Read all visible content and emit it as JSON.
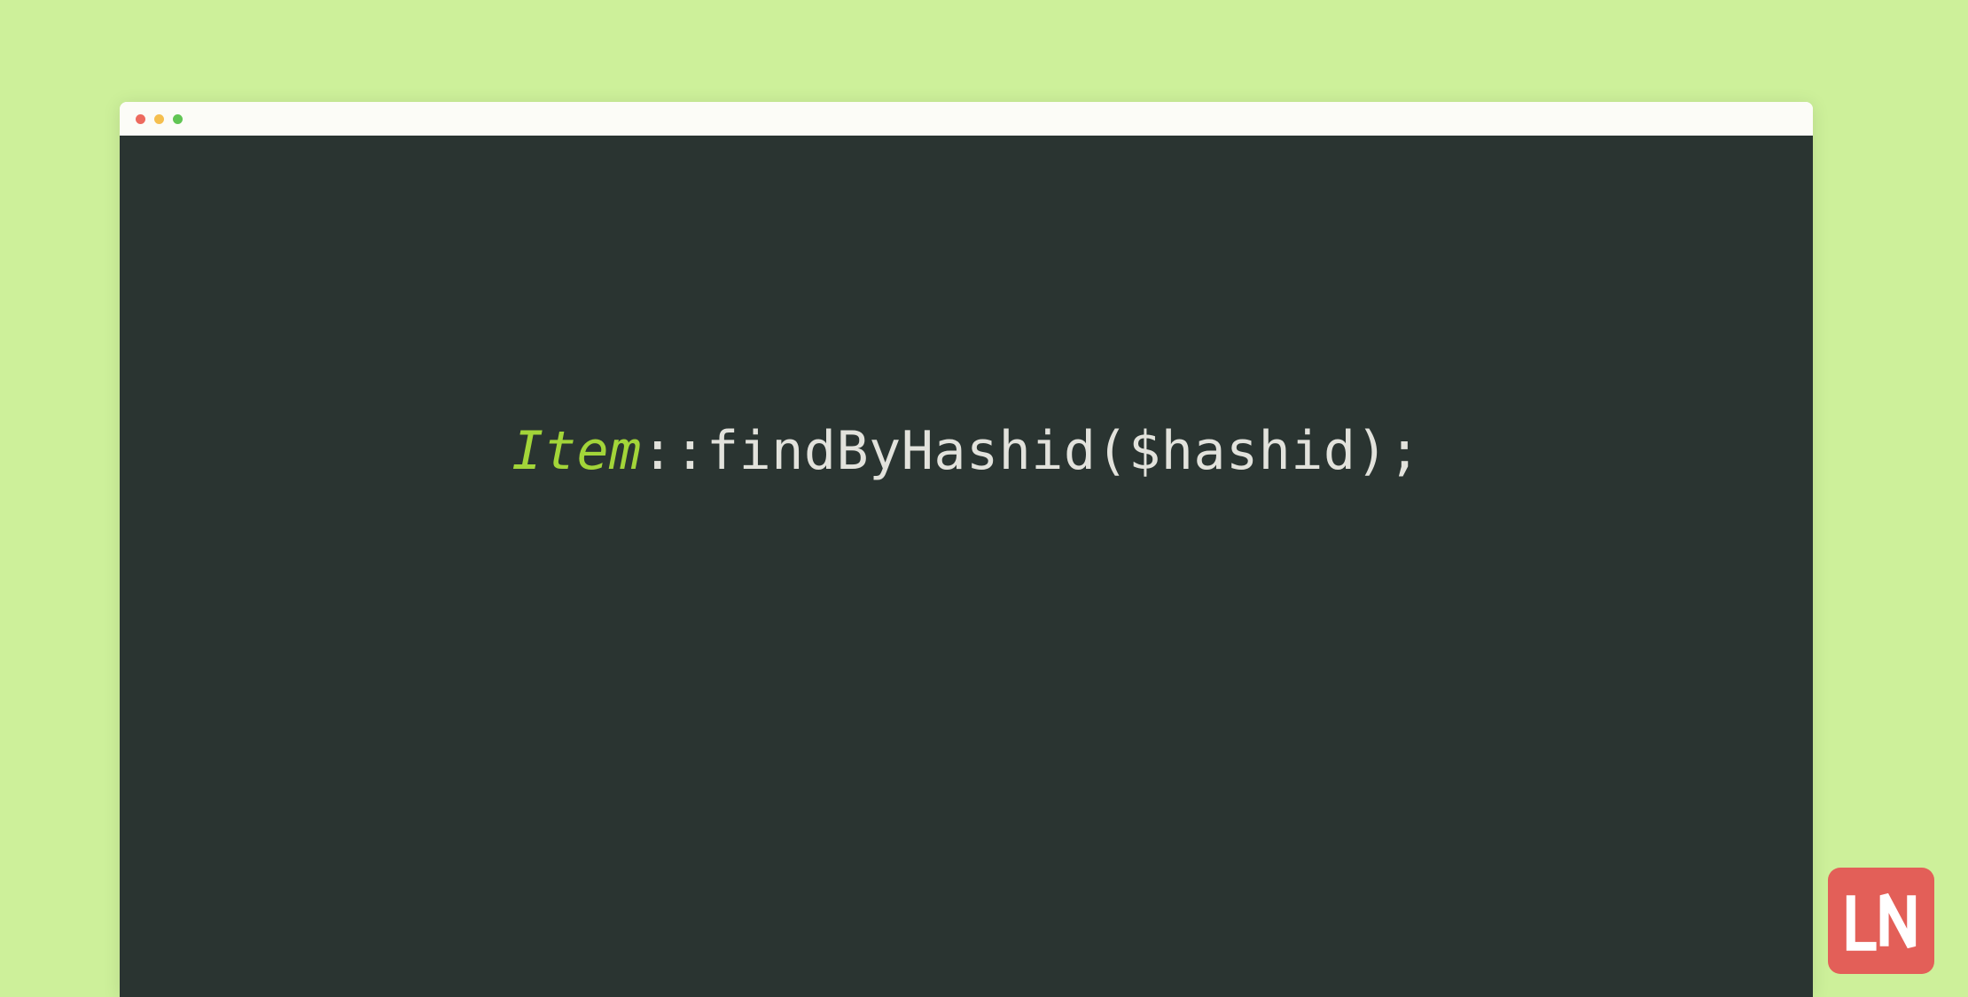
{
  "code": {
    "class_name": "Item",
    "rest": "::findByHashid($hashid);"
  },
  "logo": {
    "text": "LN"
  },
  "colors": {
    "background": "#cdf09a",
    "editor_bg": "#2a3431",
    "titlebar_bg": "#fcfcf7",
    "class_color": "#a3d539",
    "text_color": "#e2e2dc",
    "badge_bg": "#e35f58"
  }
}
